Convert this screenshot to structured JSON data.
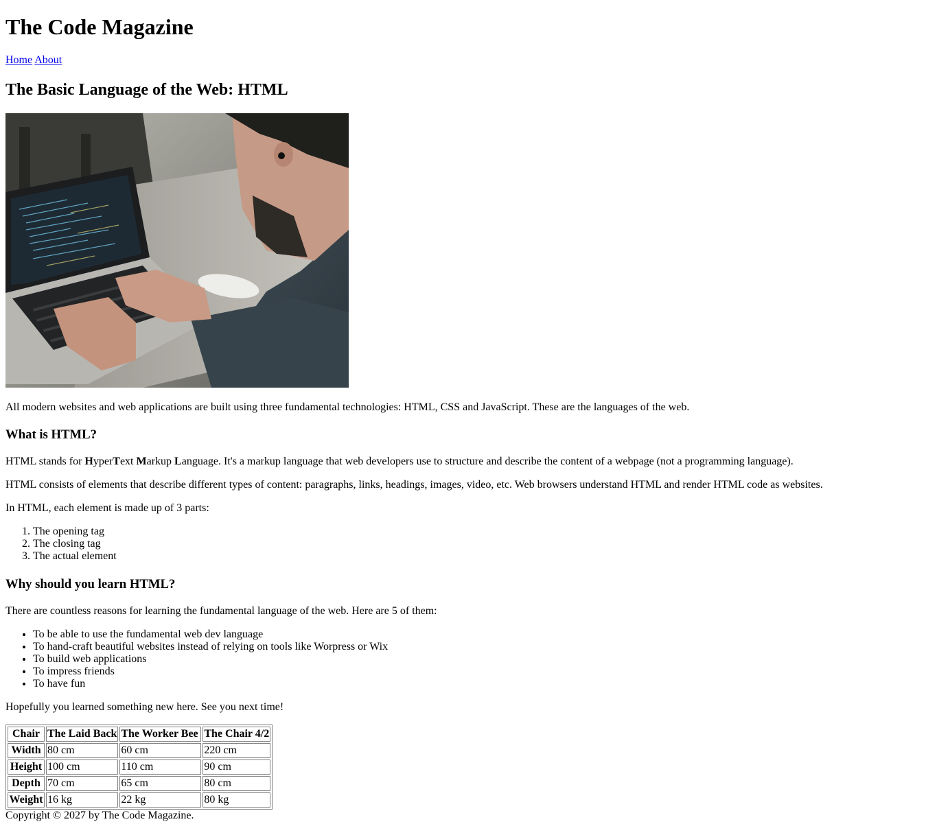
{
  "site": {
    "title": "The Code Magazine"
  },
  "nav": {
    "home": "Home",
    "about": "About"
  },
  "article": {
    "title": "The Basic Language of the Web: HTML",
    "image_alt": "Man working on a laptop with code on screen",
    "intro": "All modern websites and web applications are built using three fundamental technologies: HTML, CSS and JavaScript. These are the languages of the web.",
    "what": {
      "heading": "What is HTML?",
      "p1_before": "HTML stands for ",
      "p1_h": "H",
      "p1_yper": "yper",
      "p1_t": "T",
      "p1_ext": "ext ",
      "p1_m": "M",
      "p1_arkup": "arkup ",
      "p1_l": "L",
      "p1_anguage": "anguage",
      "p1_after": ". It's a markup language that web developers use to structure and describe the content of a webpage (not a programming language).",
      "p2": "HTML consists of elements that describe different types of content: paragraphs, links, headings, images, video, etc. Web browsers understand HTML and render HTML code as websites.",
      "p3": "In HTML, each element is made up of 3 parts:",
      "parts": [
        "The opening tag",
        "The closing tag",
        "The actual element"
      ]
    },
    "why": {
      "heading": "Why should you learn HTML?",
      "p4": "There are countless reasons for learning the fundamental language of the web. Here are 5 of them:",
      "reasons": [
        "To be able to use the fundamental web dev language",
        "To hand-craft beautiful websites instead of relying on tools like Worpress or Wix",
        "To build web applications",
        "To impress friends",
        "To have fun"
      ],
      "p5": "Hopefully you learned something new here. See you next time!"
    }
  },
  "table": {
    "headers": [
      "Chair",
      "The Laid Back",
      "The Worker Bee",
      "The Chair 4/2"
    ],
    "rows": [
      {
        "label": "Width",
        "values": [
          "80 cm",
          "60 cm",
          "220 cm"
        ]
      },
      {
        "label": "Height",
        "values": [
          "100 cm",
          "110 cm",
          "90 cm"
        ]
      },
      {
        "label": "Depth",
        "values": [
          "70 cm",
          "65 cm",
          "80 cm"
        ]
      },
      {
        "label": "Weight",
        "values": [
          "16 kg",
          "22 kg",
          "80 kg"
        ]
      }
    ]
  },
  "footer": {
    "copyright": "Copyright © 2027 by The Code Magazine."
  }
}
